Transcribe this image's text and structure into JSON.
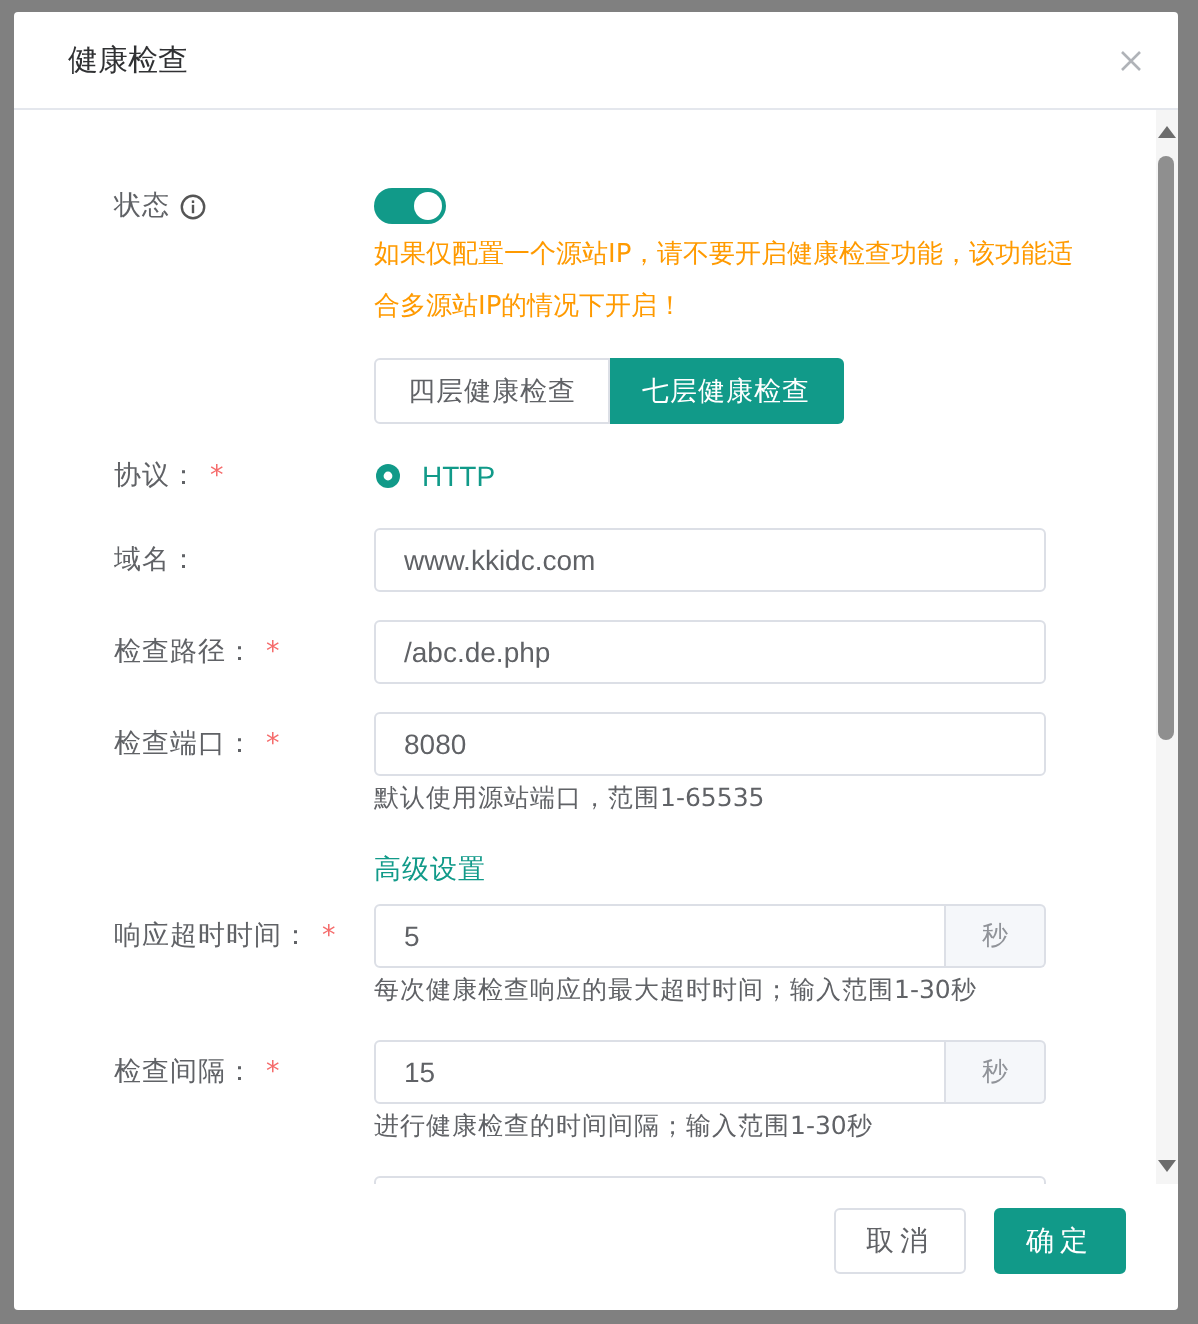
{
  "dialog": {
    "title": "健康检查"
  },
  "required_mark": "*",
  "status": {
    "label": "状态",
    "on": true,
    "warning": "如果仅配置一个源站IP，请不要开启健康检查功能，该功能适合多源站IP的情况下开启！"
  },
  "check_types": [
    {
      "label": "四层健康检查",
      "selected": false
    },
    {
      "label": "七层健康检查",
      "selected": true
    }
  ],
  "fields": [
    {
      "kind": "radio",
      "label": "协议：",
      "required": true,
      "options": [
        {
          "label": "HTTP",
          "selected": true
        }
      ]
    },
    {
      "kind": "input",
      "label": "域名：",
      "required": false,
      "value": "www.kkidc.com"
    },
    {
      "kind": "input",
      "label": "检查路径：",
      "required": true,
      "value": "/abc.de.php"
    },
    {
      "kind": "input",
      "label": "检查端口：",
      "required": true,
      "value": "8080",
      "help": "默认使用源站端口，范围1-65535"
    },
    {
      "kind": "link",
      "label": "高级设置"
    },
    {
      "kind": "input",
      "label": "响应超时时间：",
      "required": true,
      "value": "5",
      "suffix": "秒",
      "help": "每次健康检查响应的最大超时时间；输入范围1-30秒"
    },
    {
      "kind": "input",
      "label": "检查间隔：",
      "required": true,
      "value": "15",
      "suffix": "秒",
      "help": "进行健康检查的时间间隔；输入范围1-30秒"
    },
    {
      "kind": "input"
    }
  ],
  "buttons": [
    {
      "label": "取消",
      "kind": "default"
    },
    {
      "label": "确定",
      "kind": "primary"
    }
  ]
}
